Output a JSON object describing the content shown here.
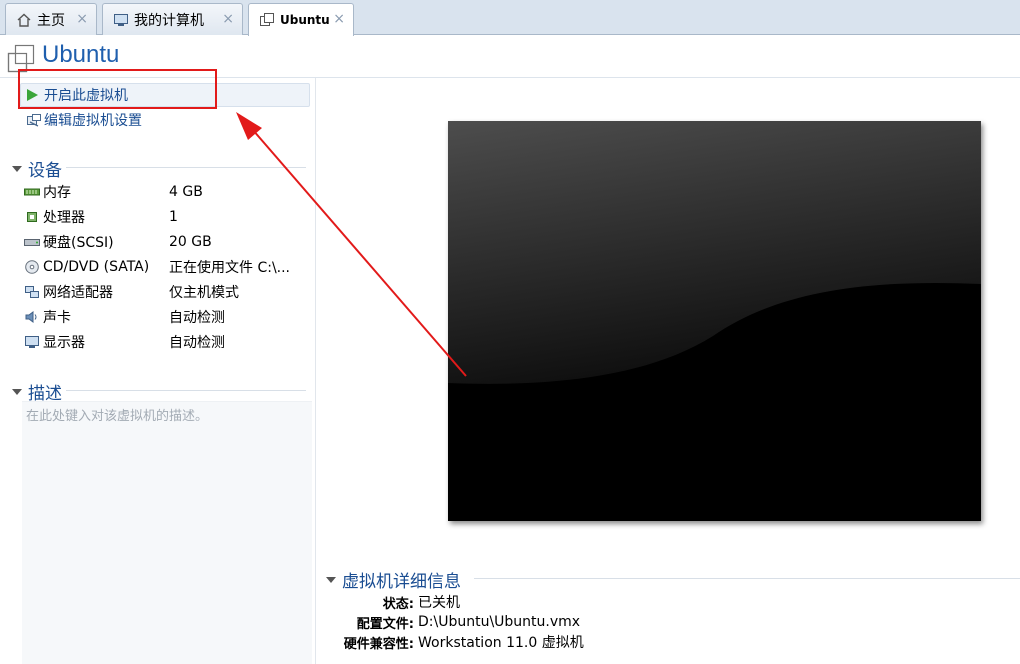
{
  "tabs": [
    {
      "label": "主页",
      "icon": "home-icon"
    },
    {
      "label": "我的计算机",
      "icon": "computer-icon"
    },
    {
      "label": "Ubuntu",
      "icon": "vm-icon",
      "active": true
    }
  ],
  "tab_close_glyph": "×",
  "vm": {
    "title": "Ubuntu"
  },
  "actions": {
    "power_on": "开启此虚拟机",
    "edit_settings": "编辑虚拟机设置"
  },
  "devices": {
    "heading": "设备",
    "items": [
      {
        "name": "内存",
        "value": "4 GB",
        "icon": "memory-icon"
      },
      {
        "name": "处理器",
        "value": "1",
        "icon": "processor-icon"
      },
      {
        "name": "硬盘(SCSI)",
        "value": "20 GB",
        "icon": "hard-disk-icon"
      },
      {
        "name": "CD/DVD (SATA)",
        "value": "正在使用文件 C:\\...",
        "icon": "cd-dvd-icon"
      },
      {
        "name": "网络适配器",
        "value": "仅主机模式",
        "icon": "network-adapter-icon"
      },
      {
        "name": "声卡",
        "value": "自动检测",
        "icon": "sound-card-icon"
      },
      {
        "name": "显示器",
        "value": "自动检测",
        "icon": "display-icon"
      }
    ]
  },
  "description": {
    "heading": "描述",
    "placeholder": "在此处键入对该虚拟机的描述。"
  },
  "details": {
    "heading": "虚拟机详细信息",
    "rows": [
      {
        "key": "状态:",
        "value": "已关机"
      },
      {
        "key": "配置文件:",
        "value": "D:\\Ubuntu\\Ubuntu.vmx"
      },
      {
        "key": "硬件兼容性:",
        "value": "Workstation 11.0 虚拟机"
      }
    ]
  },
  "colors": {
    "accent": "#1a4d92",
    "title": "#1f5fae",
    "annotation": "#e21a1a",
    "play": "#3aa53a"
  }
}
